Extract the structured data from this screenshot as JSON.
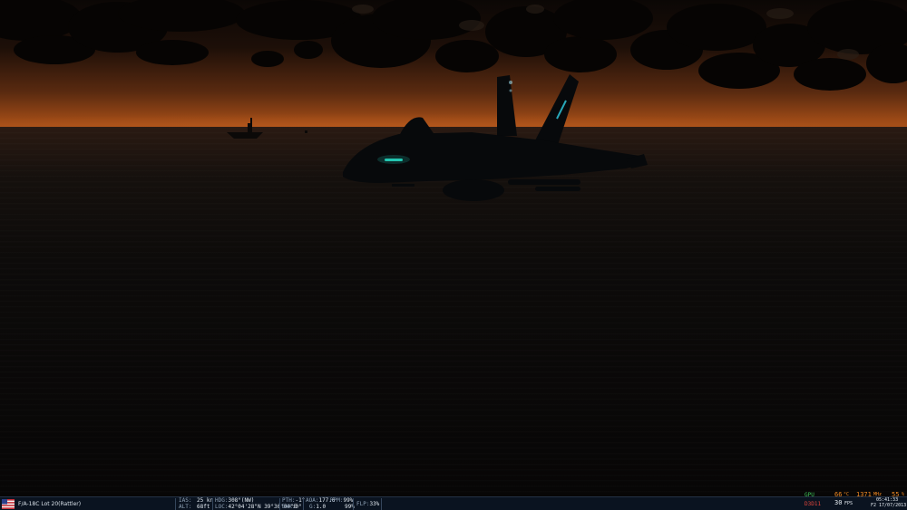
{
  "status_bar": {
    "aircraft": "F/A-18C Lot 20(Rattler)",
    "ias_label": "IAS:",
    "ias_value": "25 kn",
    "alt_label": "ALT:",
    "alt_value": "68ft",
    "hdg_label": "HDG:",
    "hdg_value": "308°(NW)",
    "loc_label": "LOC:",
    "loc_value": "42°04'28\"N 39°36'04\"E",
    "pth_label": "PTH:",
    "pth_value": "-1°",
    "bnk_label": "BNK:",
    "bnk_value": "0°",
    "aoa_label": "AOA:",
    "aoa_value": "177.6",
    "g_label": "G:",
    "g_value": "1.0",
    "rpm_label": "RPM:",
    "rpm_value1": "99%",
    "rpm_value2": "99%",
    "flp_label": "FLP:",
    "flp_value": "33%"
  },
  "perf_overlay": {
    "gpu_label": "GPU",
    "gpu_temp": "66",
    "gpu_temp_unit": "°C",
    "gpu_clock": "1371",
    "gpu_clock_unit": "MHz",
    "cpu_load": "55",
    "cpu_load_unit": "%",
    "d3d_label": "D3D11",
    "fps_value": "30",
    "fps_unit": "FPS",
    "time_value": "05:41:33",
    "date_value": "F2 17/07/2013"
  },
  "colors": {
    "hud_bg": "#0a1320",
    "perf_green": "#3fc35a",
    "perf_orange": "#f08a24",
    "canopy_glow": "#27d8c0"
  }
}
